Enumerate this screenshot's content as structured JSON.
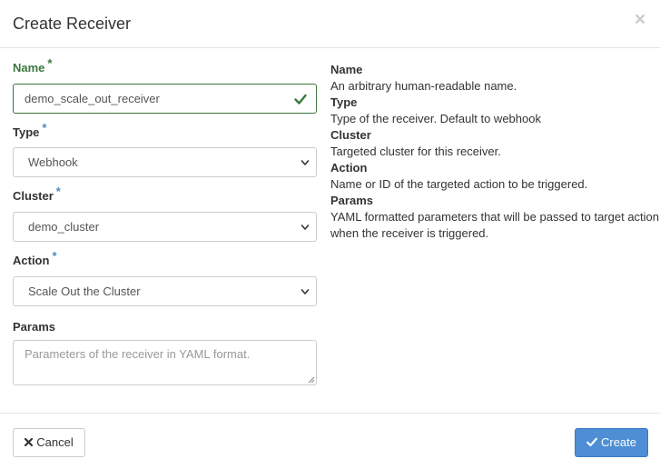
{
  "modal": {
    "title": "Create Receiver",
    "close_glyph": "×"
  },
  "form": {
    "name": {
      "label": "Name",
      "required": "*",
      "value": "demo_scale_out_receiver"
    },
    "type": {
      "label": "Type",
      "required": "*",
      "selected": "Webhook"
    },
    "cluster": {
      "label": "Cluster",
      "required": "*",
      "selected": "demo_cluster"
    },
    "action": {
      "label": "Action",
      "required": "*",
      "selected": "Scale Out the Cluster"
    },
    "params": {
      "label": "Params",
      "placeholder": "Parameters of the receiver in YAML format."
    }
  },
  "help": [
    {
      "term": "Name",
      "desc": "An arbitrary human-readable name."
    },
    {
      "term": "Type",
      "desc": "Type of the receiver. Default to webhook"
    },
    {
      "term": "Cluster",
      "desc": "Targeted cluster for this receiver."
    },
    {
      "term": "Action",
      "desc": "Name or ID of the targeted action to be triggered."
    },
    {
      "term": "Params",
      "desc": "YAML formatted parameters that will be passed to target action when the receiver is triggered."
    }
  ],
  "footer": {
    "cancel_label": "Cancel",
    "create_label": "Create"
  },
  "colors": {
    "success": "#3c763d",
    "required": "#4a8bc2",
    "primary": "#4d8ed4"
  },
  "icons": {
    "close": "close-icon",
    "check": "check-icon",
    "dropdown": "chevron-down-icon",
    "cancel": "times-icon",
    "create": "check-icon"
  }
}
